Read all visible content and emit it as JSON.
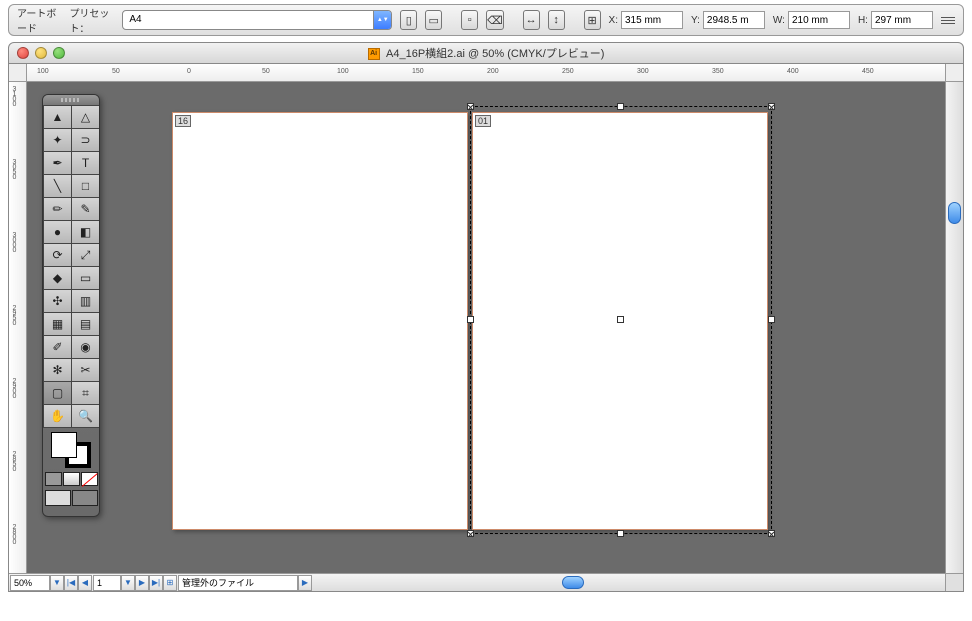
{
  "toolbar": {
    "artboard_label": "アートボード",
    "preset_label": "プリセット：",
    "preset_value": "A4",
    "x_label": "X:",
    "x_value": "315 mm",
    "y_label": "Y:",
    "y_value": "2948.5 m",
    "w_label": "W:",
    "w_value": "210 mm",
    "h_label": "H:",
    "h_value": "297 mm"
  },
  "window": {
    "ai_badge": "Ai",
    "title": "A4_16P横組2.ai @ 50% (CMYK/プレビュー)"
  },
  "ruler_h": [
    "100",
    "50",
    "0",
    "50",
    "100",
    "150",
    "200",
    "250",
    "300",
    "350",
    "400",
    "450"
  ],
  "ruler_v": [
    "3100",
    "3050",
    "3000",
    "2950",
    "2900",
    "2850",
    "2800"
  ],
  "pages": {
    "left_num": "16",
    "right_num": "01"
  },
  "status": {
    "zoom": "50%",
    "page_current": "1",
    "layer_label": "管理外のファイル"
  },
  "tools": [
    {
      "name": "selection-tool",
      "glyph": "▲"
    },
    {
      "name": "direct-selection-tool",
      "glyph": "△"
    },
    {
      "name": "wand-tool",
      "glyph": "✦"
    },
    {
      "name": "lasso-tool",
      "glyph": "⊃"
    },
    {
      "name": "pen-tool",
      "glyph": "✒"
    },
    {
      "name": "type-tool",
      "glyph": "T"
    },
    {
      "name": "line-tool",
      "glyph": "╲"
    },
    {
      "name": "rect-tool",
      "glyph": "□"
    },
    {
      "name": "brush-tool",
      "glyph": "✏"
    },
    {
      "name": "pencil-tool",
      "glyph": "✎"
    },
    {
      "name": "blob-tool",
      "glyph": "●"
    },
    {
      "name": "eraser-tool",
      "glyph": "◧"
    },
    {
      "name": "rotate-tool",
      "glyph": "⟳"
    },
    {
      "name": "scale-tool",
      "glyph": "⤢"
    },
    {
      "name": "warp-tool",
      "glyph": "◆"
    },
    {
      "name": "free-transform-tool",
      "glyph": "▭"
    },
    {
      "name": "symbol-tool",
      "glyph": "✣"
    },
    {
      "name": "graph-tool",
      "glyph": "▥"
    },
    {
      "name": "mesh-tool",
      "glyph": "▦"
    },
    {
      "name": "gradient-tool",
      "glyph": "▤"
    },
    {
      "name": "eyedrop-tool",
      "glyph": "✐"
    },
    {
      "name": "blend-tool",
      "glyph": "◉"
    },
    {
      "name": "spray-tool",
      "glyph": "✻"
    },
    {
      "name": "slice-knife-tool",
      "glyph": "✂"
    },
    {
      "name": "artboard-tool",
      "glyph": "▢",
      "selected": true
    },
    {
      "name": "slice-tool",
      "glyph": "⌗"
    },
    {
      "name": "hand-tool",
      "glyph": "✋"
    },
    {
      "name": "zoom-tool",
      "glyph": "🔍"
    }
  ]
}
